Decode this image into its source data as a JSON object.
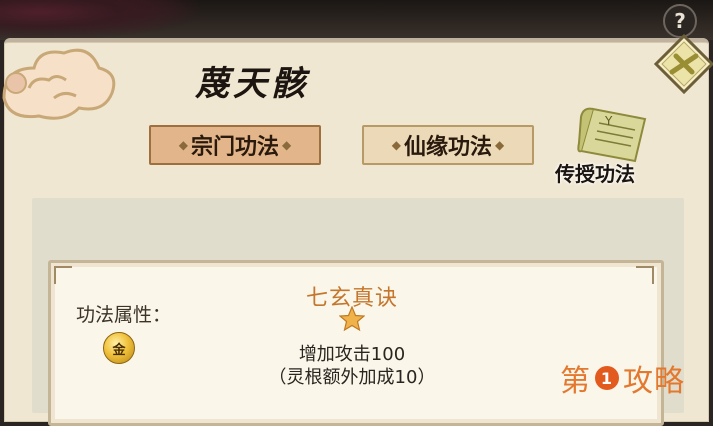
{
  "screen_title": "蔑天骸",
  "tabs": [
    {
      "label": "宗门功法",
      "active": true
    },
    {
      "label": "仙缘功法",
      "active": false
    }
  ],
  "transmit_label": "传授功法",
  "help_icon": "?",
  "skill": {
    "attribute_label": "功法属性：",
    "attribute_icon_text": "金",
    "name": "七玄真诀",
    "stars": 1,
    "effect": "增加攻击100",
    "bonus": "（灵根额外加成10）"
  },
  "watermark": {
    "left": "第",
    "badge": "1",
    "right": "攻略"
  },
  "colors": {
    "panel_bg": "#f0e7d2",
    "active_tab": "#e2b58a",
    "skill_name": "#c4762c",
    "watermark": "#e3792f"
  }
}
